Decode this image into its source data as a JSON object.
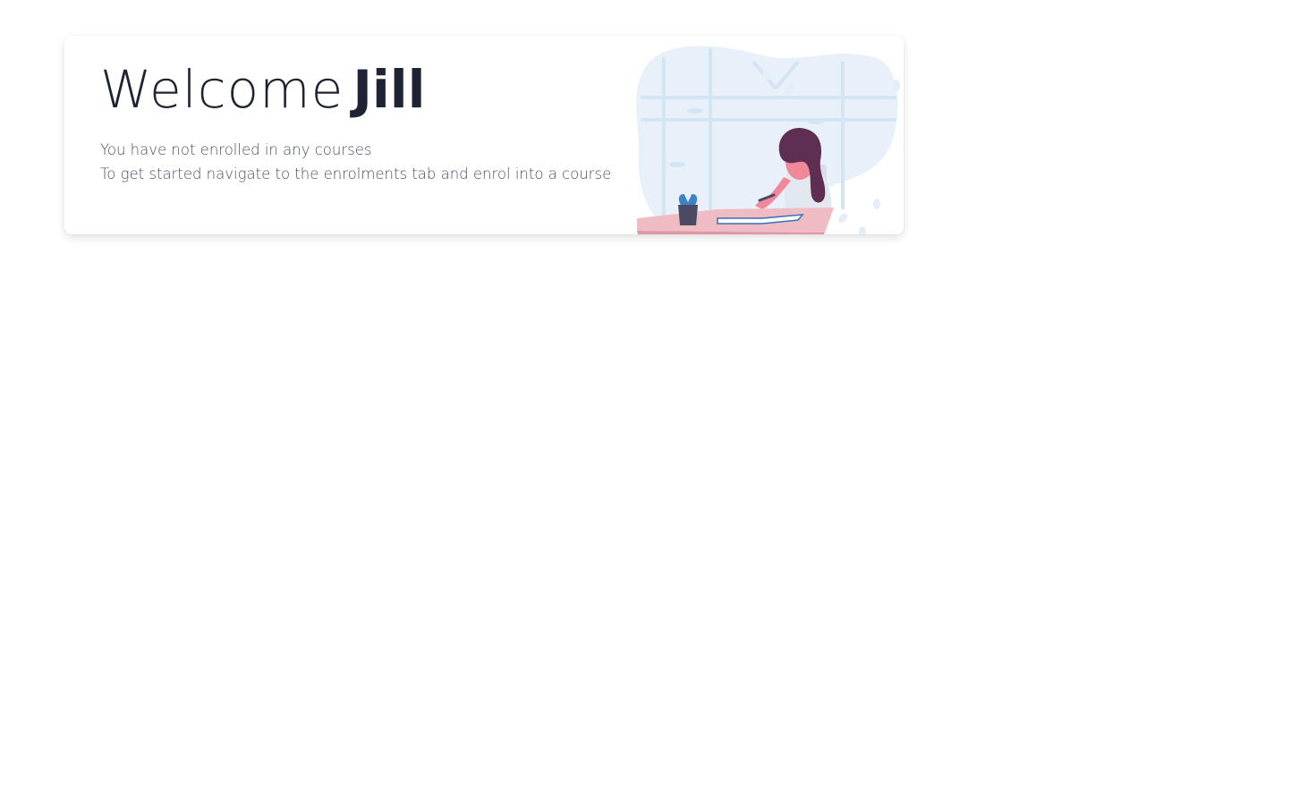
{
  "welcome": {
    "greeting": "Welcome",
    "user_name": "Jill",
    "line1": "You have not enrolled in any courses",
    "line2": "To get started navigate to the enrolments tab and enrol into a course"
  },
  "illustration": {
    "name": "student-studying-illustration",
    "colors": {
      "blob": "#e8f1fa",
      "window_frame": "#d3e4f3",
      "hair": "#5e2f52",
      "skin": "#f1889a",
      "shirt": "#e3e8ef",
      "desk_top": "#f0bcc4",
      "desk_front": "#de97a5",
      "pot": "#4a4a63",
      "plant": "#3c82c5",
      "book": "#3a6fb5"
    }
  }
}
